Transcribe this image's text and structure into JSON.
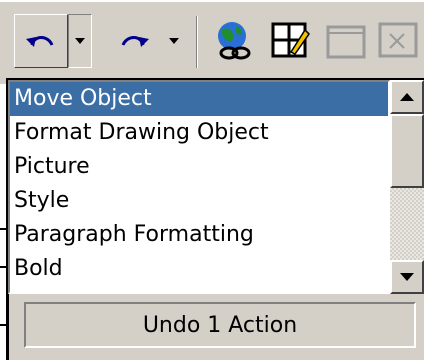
{
  "toolbar": {
    "undo_icon": "undo-arrow-icon",
    "undo_dropdown_icon": "chevron-down-icon",
    "redo_icon": "redo-arrow-icon",
    "redo_dropdown_icon": "chevron-down-icon",
    "web_icon": "globe-link-icon",
    "table_icon": "tables-borders-icon",
    "frame_icon": "frame-icon"
  },
  "undo_list": {
    "items": [
      {
        "label": "Move Object",
        "selected": true
      },
      {
        "label": "Format Drawing Object",
        "selected": false
      },
      {
        "label": "Picture",
        "selected": false
      },
      {
        "label": "Style",
        "selected": false
      },
      {
        "label": "Paragraph Formatting",
        "selected": false
      },
      {
        "label": "Bold",
        "selected": false
      }
    ],
    "status": "Undo 1 Action"
  },
  "colors": {
    "selection": "#3a6ea5",
    "face": "#d4d0c8"
  }
}
